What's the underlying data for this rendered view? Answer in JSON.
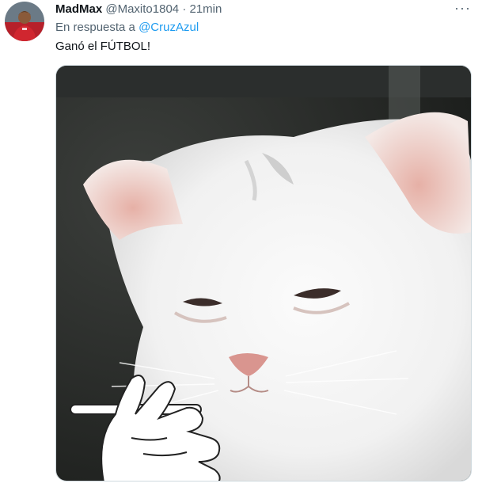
{
  "tweet": {
    "display_name": "MadMax",
    "handle": "@Maxito1804",
    "separator": "·",
    "time": "21min",
    "reply_prefix": "En respuesta a",
    "reply_to": "@CruzAzul",
    "text": "Ganó el FÚTBOL!",
    "more_icon": "more-options-icon",
    "avatar": "user-avatar",
    "media": "meme-image-crying-cat-smoking"
  },
  "colors": {
    "text": "#0f1419",
    "secondary": "#536471",
    "link": "#1d9bf0"
  }
}
